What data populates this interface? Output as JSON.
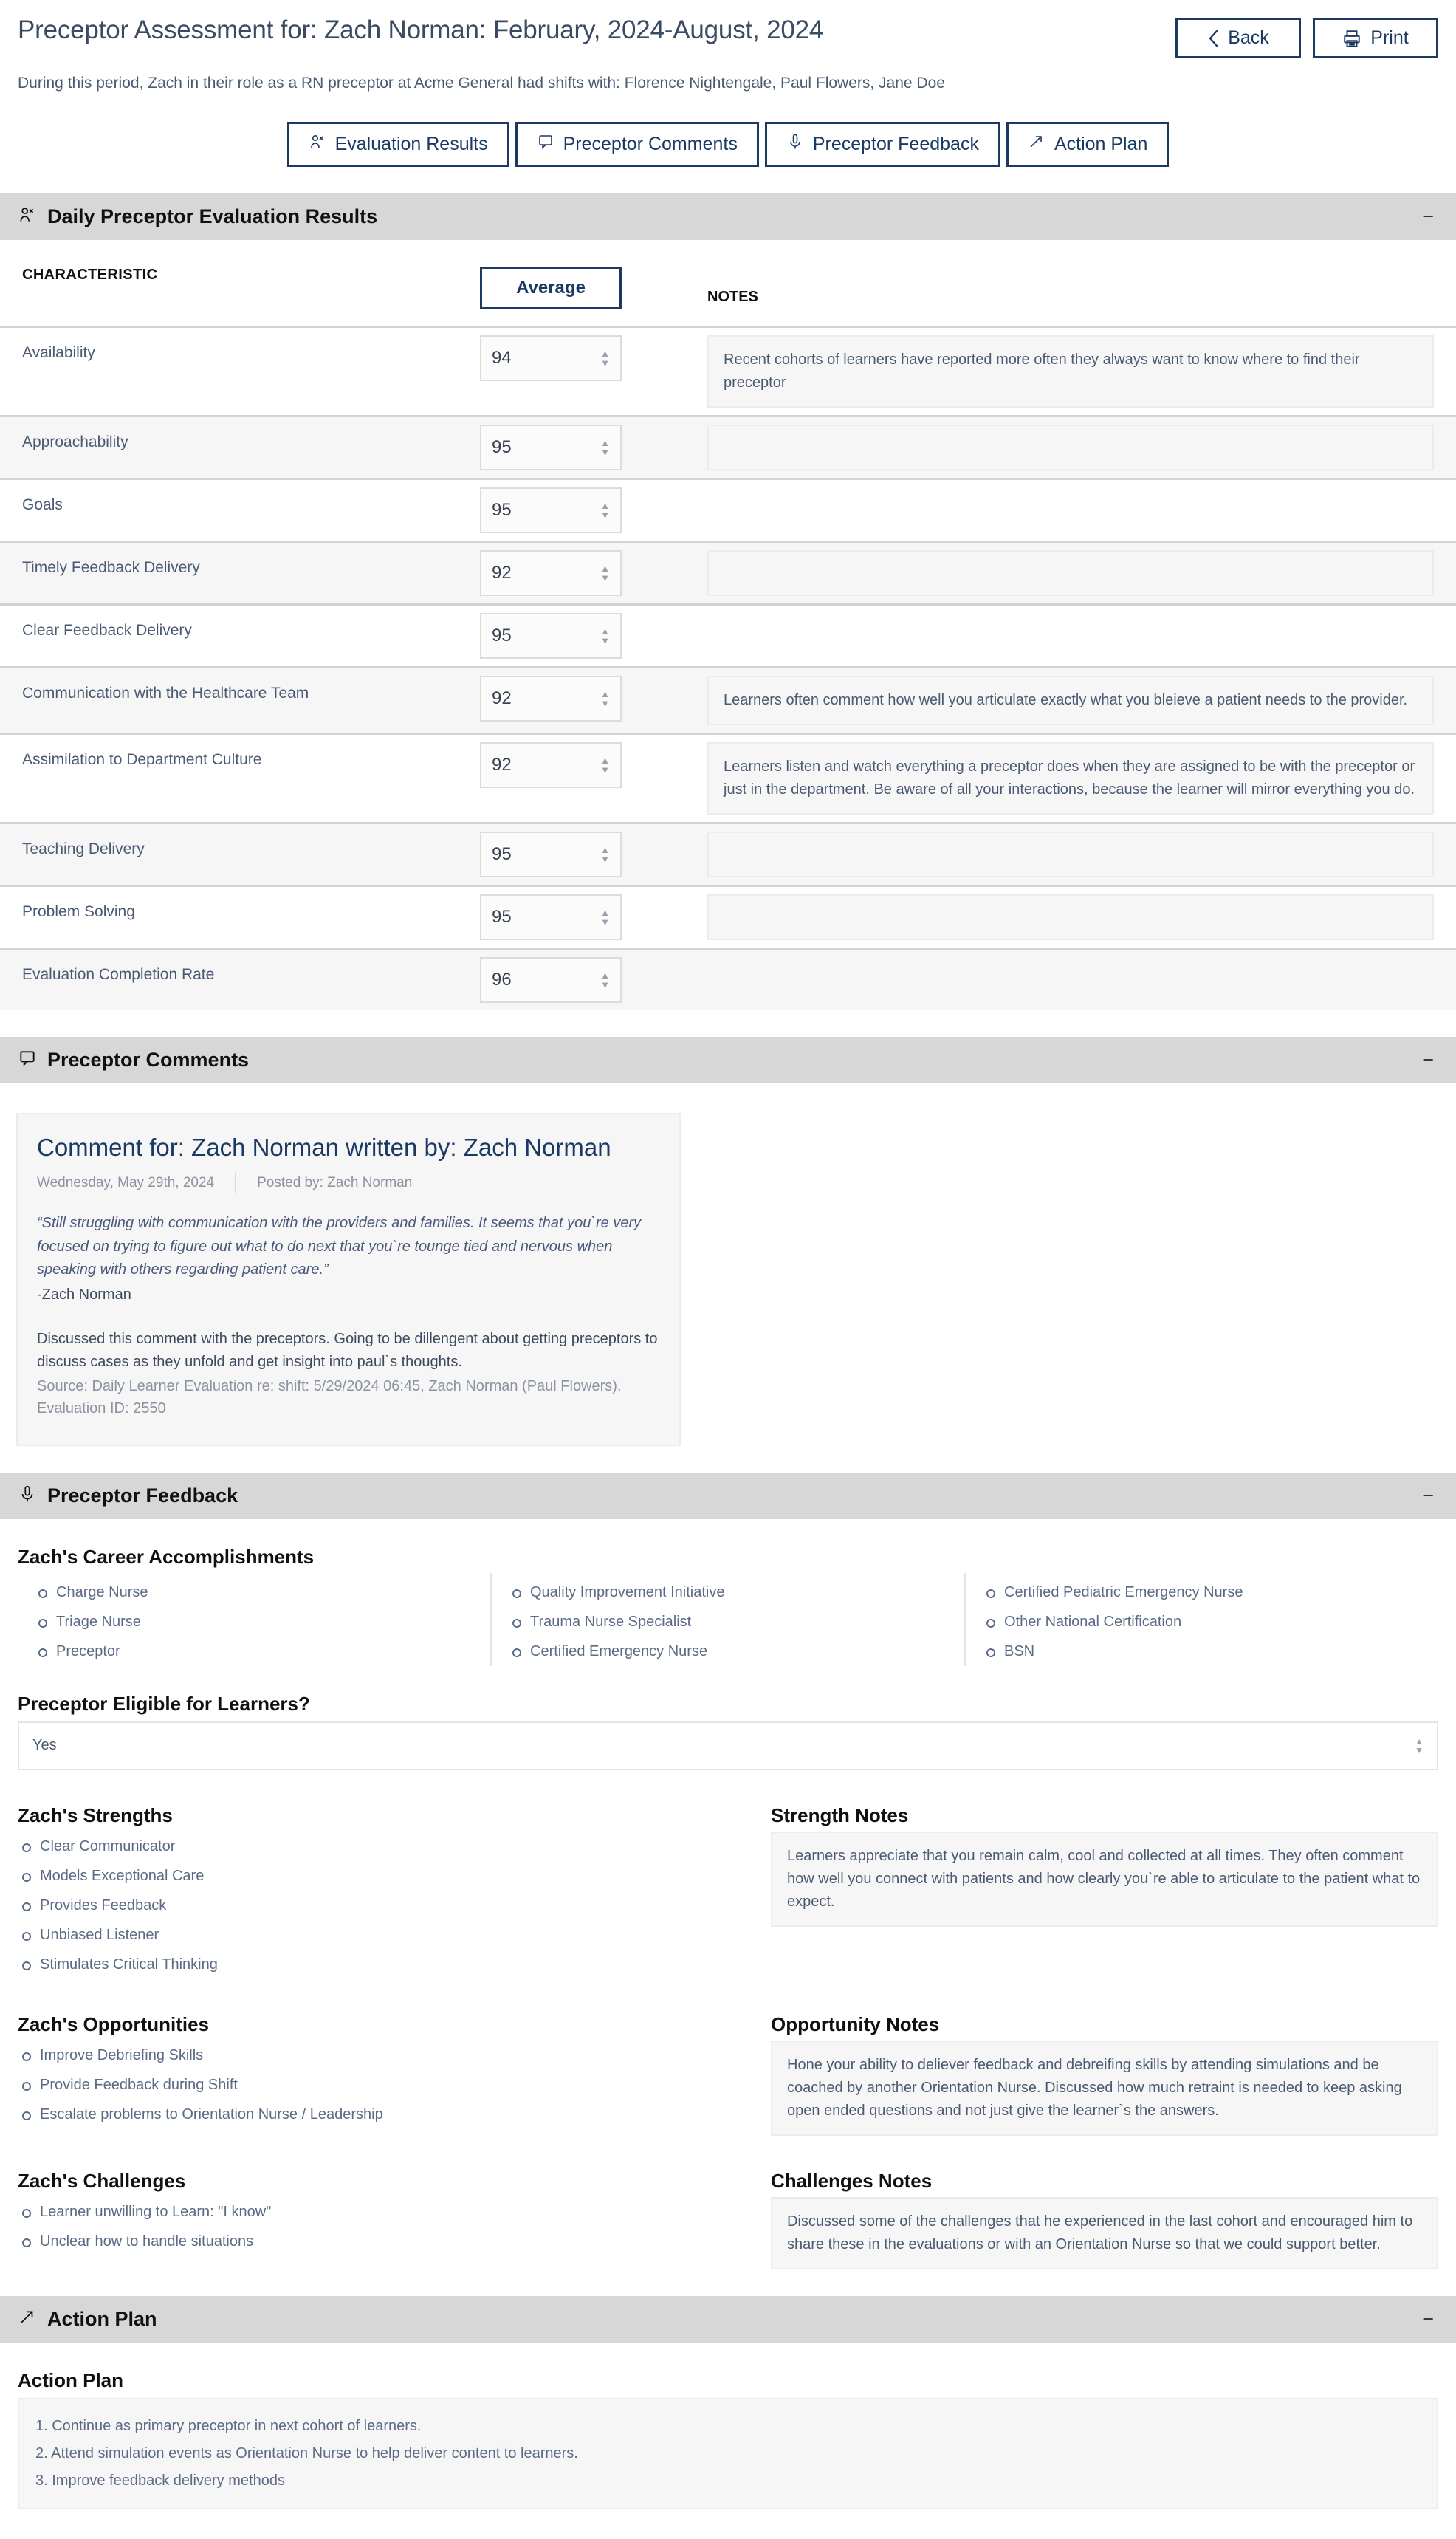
{
  "header": {
    "title": "Preceptor Assessment for: Zach Norman: February, 2024-August, 2024",
    "back_label": "Back",
    "print_label": "Print",
    "subtitle": "During this period, Zach in their role as a RN preceptor at Acme General had shifts with: Florence Nightengale, Paul Flowers, Jane Doe"
  },
  "tabs": [
    {
      "label": "Evaluation Results",
      "icon": "person-icon"
    },
    {
      "label": "Preceptor Comments",
      "icon": "comment-icon"
    },
    {
      "label": "Preceptor Feedback",
      "icon": "microphone-icon"
    },
    {
      "label": "Action Plan",
      "icon": "arrow-icon"
    }
  ],
  "sections": {
    "evaluation": {
      "title": "Daily Preceptor Evaluation Results",
      "collapse": "−"
    },
    "comments": {
      "title": "Preceptor Comments",
      "collapse": "−"
    },
    "feedback": {
      "title": "Preceptor Feedback",
      "collapse": "−"
    },
    "action_plan": {
      "title": "Action Plan",
      "collapse": "−"
    }
  },
  "evaluation_table": {
    "col_characteristic": "CHARACTERISTIC",
    "col_average": "Average",
    "col_notes": "NOTES",
    "rows": [
      {
        "characteristic": "Availability",
        "average": "94",
        "note": "Recent cohorts of learners have reported more often they always want to know where to find their preceptor",
        "has_note_box": true
      },
      {
        "characteristic": "Approachability",
        "average": "95",
        "note": "",
        "has_note_box": true
      },
      {
        "characteristic": "Goals",
        "average": "95",
        "note": "",
        "has_note_box": false
      },
      {
        "characteristic": "Timely Feedback Delivery",
        "average": "92",
        "note": "",
        "has_note_box": true
      },
      {
        "characteristic": "Clear Feedback Delivery",
        "average": "95",
        "note": "",
        "has_note_box": false
      },
      {
        "characteristic": "Communication with the Healthcare Team",
        "average": "92",
        "note": "Learners often comment how well you articulate exactly what you bleieve a patient needs to the provider.",
        "has_note_box": true
      },
      {
        "characteristic": "Assimilation to Department Culture",
        "average": "92",
        "note": "Learners listen and watch everything a preceptor does when they are assigned to be with the preceptor or just in the department. Be aware of all your interactions, because the learner will mirror everything you do.",
        "has_note_box": true
      },
      {
        "characteristic": "Teaching Delivery",
        "average": "95",
        "note": "",
        "has_note_box": true
      },
      {
        "characteristic": "Problem Solving",
        "average": "95",
        "note": "",
        "has_note_box": true
      },
      {
        "characteristic": "Evaluation Completion Rate",
        "average": "96",
        "note": "",
        "has_note_box": false
      }
    ]
  },
  "comment": {
    "title": "Comment for: Zach Norman written by: Zach Norman",
    "date": "Wednesday, May 29th, 2024",
    "posted_by": "Posted by: Zach Norman",
    "quote": "“Still struggling with communication with the providers and families. It seems that you`re very focused on trying to figure out what to do next that you`re tounge tied and nervous when speaking with others regarding patient care.”",
    "signature": "-Zach Norman",
    "body": "Discussed this comment with the preceptors. Going to be dillengent about getting preceptors to discuss cases as they unfold and get insight into paul`s thoughts.",
    "source": "Source: Daily Learner Evaluation re: shift: 5/29/2024 06:45, Zach Norman (Paul Flowers). Evaluation ID: 2550"
  },
  "feedback": {
    "accomplishments_title": "Zach's Career Accomplishments",
    "accomplishments_col1": [
      "Charge Nurse",
      "Triage Nurse",
      "Preceptor"
    ],
    "accomplishments_col2": [
      "Quality Improvement Initiative",
      "Trauma Nurse Specialist",
      "Certified Emergency Nurse"
    ],
    "accomplishments_col3": [
      "Certified Pediatric Emergency Nurse",
      "Other National Certification",
      "BSN"
    ],
    "eligible_title": "Preceptor Eligible for Learners?",
    "eligible_value": "Yes",
    "strengths_title": "Zach's Strengths",
    "strengths": [
      "Clear Communicator",
      "Models Exceptional Care",
      "Provides Feedback",
      "Unbiased Listener",
      "Stimulates Critical Thinking"
    ],
    "strength_notes_title": "Strength Notes",
    "strength_notes": "Learners appreciate that you remain calm, cool and collected at all times. They often comment how well you connect with patients and how clearly you`re able to articulate to the patient what to expect.",
    "opportunities_title": "Zach's Opportunities",
    "opportunities": [
      "Improve Debriefing Skills",
      "Provide Feedback during Shift",
      "Escalate problems to Orientation Nurse / Leadership"
    ],
    "opportunity_notes_title": "Opportunity Notes",
    "opportunity_notes": "Hone your ability to deliever feedback and debreifing skills by attending simulations and be coached by another Orientation Nurse. Discussed how much retraint is needed to keep asking open ended questions and not just give the learner`s the answers.",
    "challenges_title": "Zach's Challenges",
    "challenges": [
      "Learner unwilling to Learn: \"I know\"",
      "Unclear how to handle situations"
    ],
    "challenges_notes_title": "Challenges Notes",
    "challenges_notes": "Discussed some of the challenges that he experienced in the last cohort and encouraged him to share these in the evaluations or with an Orientation Nurse so that we could support better."
  },
  "action_plan": {
    "heading": "Action Plan",
    "items": [
      "1. Continue as primary preceptor in next cohort of learners.",
      "2. Attend simulation events as Orientation Nurse to help deliver content to learners.",
      "3. Improve feedback delivery methods"
    ]
  },
  "colors": {
    "accent": "#1b3a63",
    "section_bar": "#d7d7d7",
    "text": "#4a5a72"
  }
}
